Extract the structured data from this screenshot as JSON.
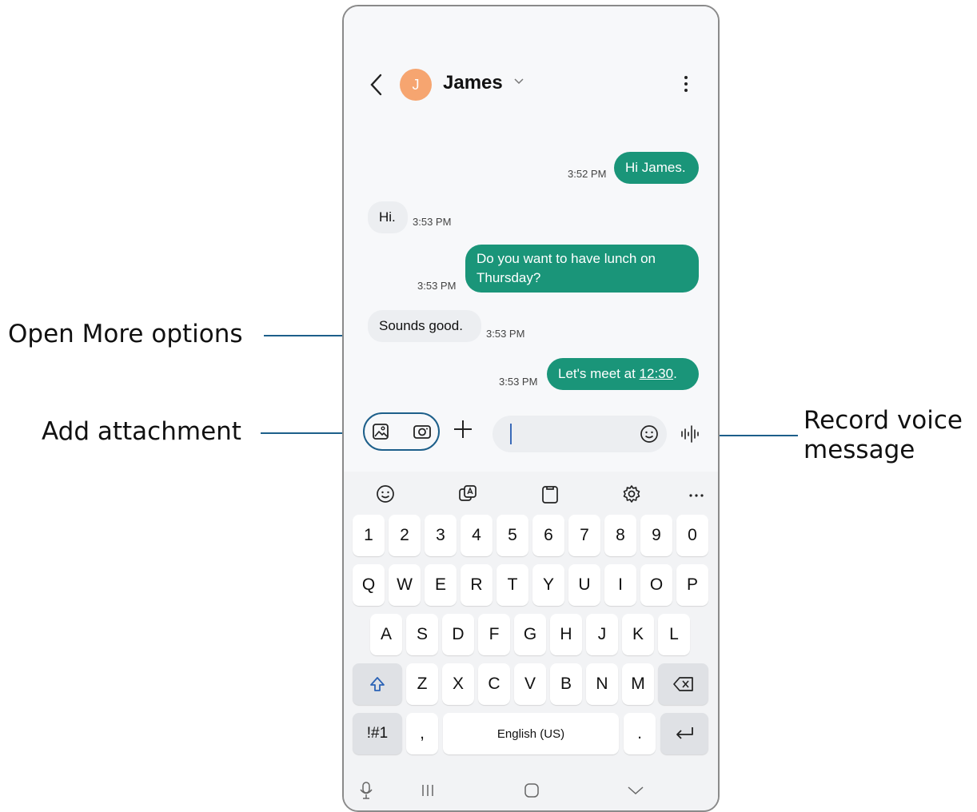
{
  "callouts": {
    "more_options": "Open More options",
    "attachment": "Add attachment",
    "voice_line1": "Record voice",
    "voice_line2": "message"
  },
  "header": {
    "avatar_initial": "J",
    "contact_name": "James"
  },
  "messages": [
    {
      "dir": "out",
      "text": "Hi James.",
      "time": "3:52 PM"
    },
    {
      "dir": "in",
      "text": "Hi.",
      "time": "3:53 PM"
    },
    {
      "dir": "out",
      "text_line1": "Do you want to have lunch on",
      "text_line2": "Thursday?",
      "time": "3:53 PM"
    },
    {
      "dir": "in",
      "text": "Sounds good.",
      "time": "3:53 PM"
    },
    {
      "dir": "out",
      "text_prefix": "Let's meet at ",
      "link": "12:30",
      "text_suffix": ".",
      "time": "3:53 PM"
    }
  ],
  "keyboard": {
    "row_numbers": [
      "1",
      "2",
      "3",
      "4",
      "5",
      "6",
      "7",
      "8",
      "9",
      "0"
    ],
    "row_top": [
      "Q",
      "W",
      "E",
      "R",
      "T",
      "Y",
      "U",
      "I",
      "O",
      "P"
    ],
    "row_middle": [
      "A",
      "S",
      "D",
      "F",
      "G",
      "H",
      "J",
      "K",
      "L"
    ],
    "row_bottom": [
      "Z",
      "X",
      "C",
      "V",
      "B",
      "N",
      "M"
    ],
    "symbols_key": "!#1",
    "comma_key": ",",
    "space_label": "English (US)",
    "period_key": "."
  },
  "icons": {
    "accent": "#1a9579",
    "callout_line": "#1d5f8a"
  }
}
